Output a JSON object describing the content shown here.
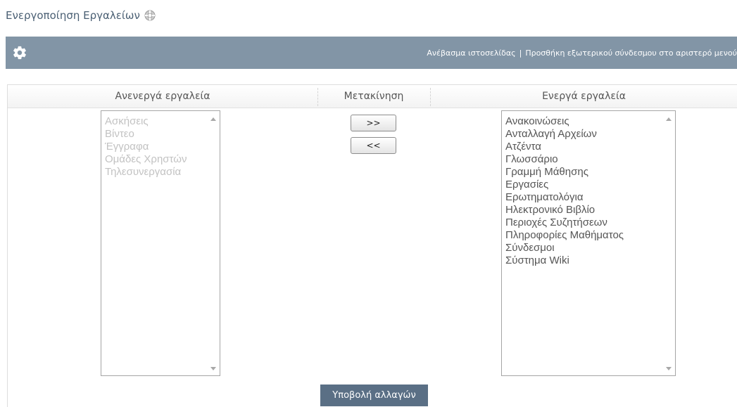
{
  "page": {
    "title": "Ενεργοποίηση Εργαλείων",
    "help_icon": "help-lifebuoy-icon"
  },
  "toolbar": {
    "settings_icon": "gear-icon",
    "upload_website_link": "Ανέβασμα ιστοσελίδας",
    "separator": "|",
    "add_external_link": "Προσθήκη εξωτερικού σύνδεσμου στο αριστερό μενού",
    "background_color": "#8295a6"
  },
  "columns": {
    "inactive_title": "Ανενεργά εργαλεία",
    "move_title": "Μετακίνηση",
    "active_title": "Ενεργά εργαλεία"
  },
  "inactive_tools": [
    "Ασκήσεις",
    "Βίντεο",
    "Έγγραφα",
    "Ομάδες Χρηστών",
    "Τηλεσυνεργασία"
  ],
  "active_tools": [
    "Ανακοινώσεις",
    "Ανταλλαγή Αρχείων",
    "Ατζέντα",
    "Γλωσσάριο",
    "Γραμμή Μάθησης",
    "Εργασίες",
    "Ερωτηματολόγια",
    "Ηλεκτρονικό Βιβλίο",
    "Περιοχές Συζητήσεων",
    "Πληροφορίες Μαθήματος",
    "Σύνδεσμοι",
    "Σύστημα Wiki"
  ],
  "buttons": {
    "move_right": ">>",
    "move_left": "<<",
    "submit": "Υποβολή αλλαγών",
    "submit_color": "#5a6f85"
  }
}
